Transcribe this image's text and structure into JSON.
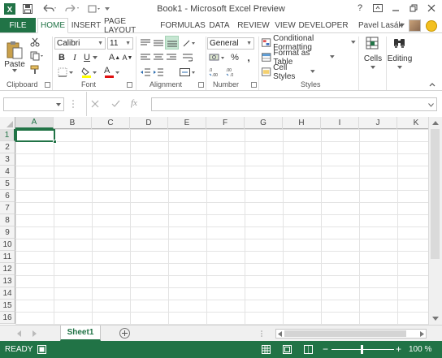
{
  "title_bar": {
    "title": "Book1 - Microsoft Excel Preview",
    "help": "?",
    "quick_access": [
      "save",
      "undo",
      "redo",
      "customize"
    ]
  },
  "tabs": {
    "file": "FILE",
    "items": [
      "HOME",
      "INSERT",
      "PAGE LAYOUT",
      "FORMULAS",
      "DATA",
      "REVIEW",
      "VIEW",
      "DEVELOPER"
    ],
    "active": "HOME",
    "user": "Pavel Lasák"
  },
  "ribbon": {
    "clipboard": {
      "paste": "Paste",
      "label": "Clipboard"
    },
    "font": {
      "name": "Calibri",
      "size": "11",
      "bold": "B",
      "italic": "I",
      "underline": "U",
      "grow": "A",
      "shrink": "A",
      "color_letter": "A",
      "label": "Font"
    },
    "alignment": {
      "label": "Alignment"
    },
    "number": {
      "format": "General",
      "percent": "%",
      "comma": ",",
      "label": "Number"
    },
    "styles": {
      "conditional": "Conditional Formatting",
      "table": "Format as Table",
      "cell_styles": "Cell Styles",
      "label": "Styles"
    },
    "cells": {
      "label": "Cells"
    },
    "editing": {
      "label": "Editing"
    }
  },
  "formula_bar": {
    "name_box": "",
    "fx": "fx",
    "value": ""
  },
  "grid": {
    "columns": [
      "A",
      "B",
      "C",
      "D",
      "E",
      "F",
      "G",
      "H",
      "I",
      "J",
      "K"
    ],
    "rows": [
      "1",
      "2",
      "3",
      "4",
      "5",
      "6",
      "7",
      "8",
      "9",
      "10",
      "11",
      "12",
      "13",
      "14",
      "15",
      "16"
    ],
    "active_cell": "A1"
  },
  "sheets": {
    "tabs": [
      "Sheet1"
    ],
    "active": "Sheet1"
  },
  "status": {
    "text": "READY",
    "zoom": "100 %"
  },
  "colors": {
    "accent": "#217346",
    "grid_line": "#e3e3e3"
  }
}
